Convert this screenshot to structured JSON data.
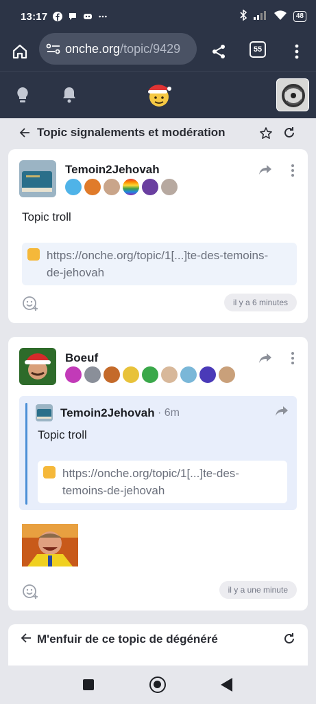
{
  "status_bar": {
    "time": "13:17",
    "battery": "48"
  },
  "browser": {
    "url_host": "onche.org",
    "url_path": "/topic/9429",
    "tab_count": "55"
  },
  "topic_bar": {
    "title": "Topic signalements et modération"
  },
  "posts": [
    {
      "author": "Temoin2Jehovah",
      "text": "Topic troll",
      "link_line1": "https://onche.org/topic/1[...]te-des-temoins-",
      "link_line2": "de-jehovah",
      "time": "il y a 6 minutes"
    },
    {
      "author": "Boeuf",
      "quote": {
        "author": "Temoin2Jehovah",
        "separator": "·",
        "time": "6m",
        "text": "Topic troll",
        "link_line1": "https://onche.org/topic/1[...]te-des-",
        "link_line2": "temoins-de-jehovah"
      },
      "time": "il y a une minute"
    }
  ],
  "next_topic": {
    "title": "M'enfuir de ce topic de dégénéré"
  },
  "colors": {
    "header_bg": "#2c3446",
    "page_bg": "#e6e7ec",
    "quote_bg": "#e8eefb",
    "quote_bar": "#4b8fd6"
  },
  "icons": [
    "home-icon",
    "share-icon",
    "tabs-icon",
    "menu-icon",
    "bulb-icon",
    "bell-icon",
    "back-arrow-icon",
    "star-icon",
    "refresh-icon",
    "reaction-icon",
    "dots-icon"
  ]
}
